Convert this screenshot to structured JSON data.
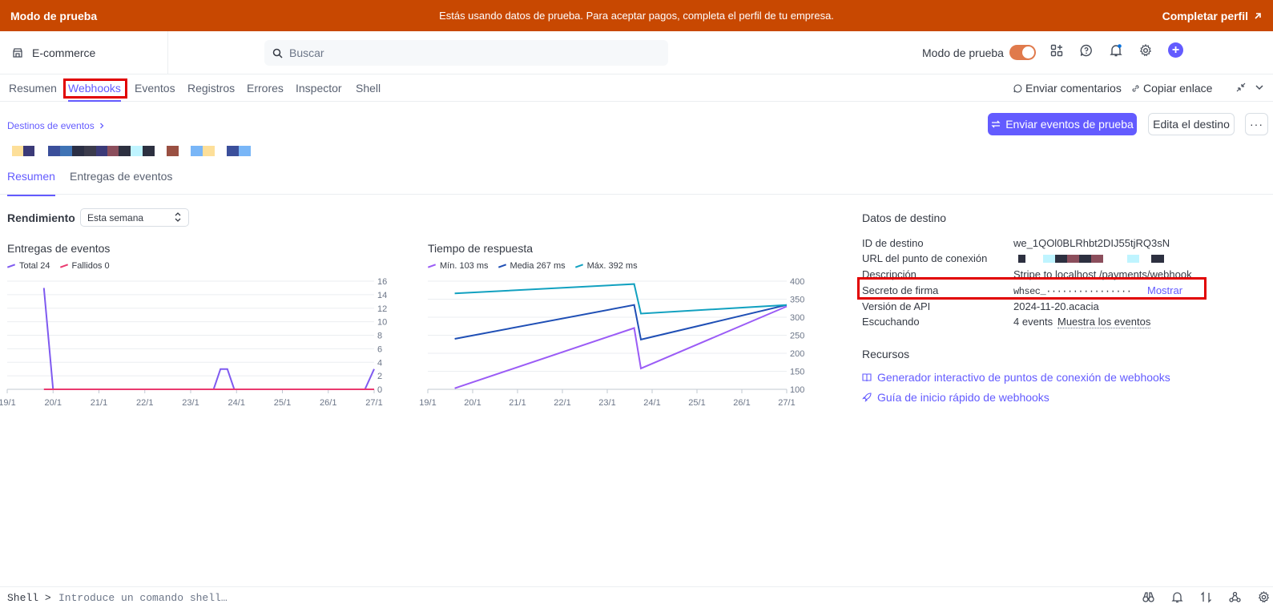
{
  "banner": {
    "left": "Modo de prueba",
    "center": "Estás usando datos de prueba. Para aceptar pagos, completa el perfil de tu empresa.",
    "right": "Completar perfil"
  },
  "header": {
    "account": "E-commerce",
    "search_placeholder": "Buscar",
    "test_mode_label": "Modo de prueba"
  },
  "top_tabs": [
    "Resumen",
    "Webhooks",
    "Eventos",
    "Registros",
    "Errores",
    "Inspector",
    "Shell"
  ],
  "top_right": {
    "feedback": "Enviar comentarios",
    "copy_link": "Copiar enlace"
  },
  "page": {
    "breadcrumb": "Destinos de eventos",
    "send_test_button": "Enviar eventos de prueba",
    "edit_button": "Edita el destino",
    "more_button": "···"
  },
  "sub_tabs": [
    "Resumen",
    "Entregas de eventos"
  ],
  "performance": {
    "title": "Rendimiento",
    "period": "Esta semana"
  },
  "deliveries_chart": {
    "title": "Entregas de eventos",
    "legend": [
      "Total 24",
      "Fallidos 0"
    ],
    "colors": [
      "#7f5af0",
      "#ea3a6f"
    ]
  },
  "response_chart": {
    "title": "Tiempo de respuesta",
    "legend": [
      "Mín. 103 ms",
      "Media 267 ms",
      "Máx. 392 ms"
    ],
    "colors": [
      "#9b5cf6",
      "#1f4fb5",
      "#12a1c0"
    ]
  },
  "chart_data": [
    {
      "type": "line",
      "title": "Entregas de eventos",
      "categories": [
        "19/1",
        "20/1",
        "21/1",
        "22/1",
        "23/1",
        "24/1",
        "25/1",
        "26/1",
        "27/1"
      ],
      "ylim": [
        0,
        16
      ],
      "yticks": [
        "0",
        "2",
        "4",
        "6",
        "8",
        "10",
        "12",
        "14",
        "16"
      ],
      "series": [
        {
          "name": "Total 24",
          "points": [
            [
              19.8,
              15
            ],
            [
              20.0,
              0
            ],
            [
              23.5,
              0
            ],
            [
              23.65,
              3
            ],
            [
              23.8,
              3
            ],
            [
              23.95,
              0
            ],
            [
              26.8,
              0
            ],
            [
              27.0,
              3
            ]
          ]
        },
        {
          "name": "Fallidos 0",
          "points": [
            [
              19.8,
              0
            ],
            [
              27.0,
              0
            ]
          ]
        }
      ]
    },
    {
      "type": "line",
      "title": "Tiempo de respuesta",
      "categories": [
        "19/1",
        "20/1",
        "21/1",
        "22/1",
        "23/1",
        "24/1",
        "25/1",
        "26/1",
        "27/1"
      ],
      "ylim": [
        100,
        400
      ],
      "yticks": [
        "100",
        "150",
        "200",
        "250",
        "300",
        "350",
        "400"
      ],
      "series": [
        {
          "name": "Mín. 103 ms",
          "points": [
            [
              19.6,
              103
            ],
            [
              23.6,
              270
            ],
            [
              23.75,
              158
            ],
            [
              27.0,
              330
            ]
          ]
        },
        {
          "name": "Media 267 ms",
          "points": [
            [
              19.6,
              240
            ],
            [
              23.6,
              334
            ],
            [
              23.75,
              238
            ],
            [
              27.0,
              334
            ]
          ]
        },
        {
          "name": "Máx. 392 ms",
          "points": [
            [
              19.6,
              366
            ],
            [
              23.6,
              392
            ],
            [
              23.75,
              310
            ],
            [
              27.0,
              334
            ]
          ]
        }
      ]
    }
  ],
  "destination": {
    "title": "Datos de destino",
    "rows": [
      {
        "label": "ID de destino",
        "value": "we_1QOl0BLRhbt2DIJ55tjRQ3sN"
      },
      {
        "label": "URL del punto de conexión",
        "value": ""
      },
      {
        "label": "Descripción",
        "value": "Stripe to localhost /payments/webhook"
      },
      {
        "label": "Secreto de firma",
        "value": "whsec_················",
        "action": "Mostrar"
      },
      {
        "label": "Versión de API",
        "value": "2024-11-20.acacia"
      },
      {
        "label": "Escuchando",
        "value": "4 events",
        "action": "Muestra los eventos"
      }
    ]
  },
  "resources": {
    "title": "Recursos",
    "links": [
      "Generador interactivo de puntos de conexión de webhooks",
      "Guía de inicio rápido de webhooks"
    ]
  },
  "shell": {
    "label": "Shell",
    "placeholder": "Introduce un comando shell…"
  }
}
